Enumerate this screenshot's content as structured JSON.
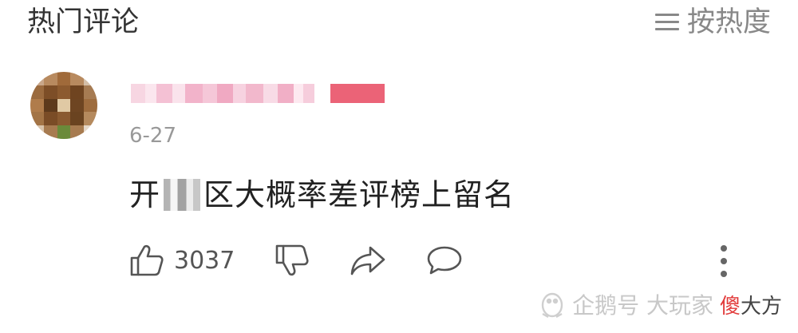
{
  "header": {
    "title": "热门评论",
    "sort_label": "按热度"
  },
  "comment": {
    "date": "6-27",
    "text_before": "开",
    "text_after": "区大概率差评榜上留名",
    "likes": "3037"
  },
  "watermark": {
    "text": "企鹅号 大玩家",
    "emph_red": "傻",
    "emph_tail": "大方"
  },
  "icons": {
    "sort": "list-icon",
    "like": "thumb-up-icon",
    "dislike": "thumb-down-icon",
    "share": "share-arrow-icon",
    "reply": "speech-bubble-icon",
    "more": "more-vertical-icon",
    "brand": "penguin-logo-icon"
  }
}
